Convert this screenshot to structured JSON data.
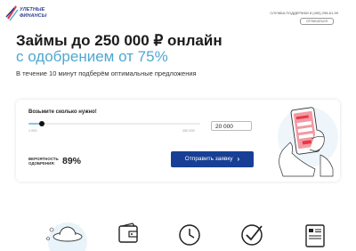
{
  "header": {
    "logo_line1": "УЛЕТНЫЕ",
    "logo_line2": "ФИНАНСЫ",
    "support": "СЛУЖБА ПОДДЕРЖКИ 8 (495) 298-61-99",
    "logout_label": "ОТПИСАТЬСЯ"
  },
  "hero": {
    "title": "Займы до 250 000 ₽ онлайн",
    "subtitle": "с одобрением от 75%",
    "lead": "В течение 10 минут подберём оптимальные предложения"
  },
  "calculator": {
    "question": "Возьмите сколько нужно!",
    "min_label": "1 000",
    "max_label": "250 000",
    "slider_min": 1000,
    "slider_max": 250000,
    "slider_value": 20000,
    "amount_value": "20 000",
    "probability_label": "ВЕРОЯТНОСТЬ ОДОБРЕНИЯ:",
    "probability_value": "89%",
    "submit_label": "Отправить заявку"
  },
  "features": {
    "icons": [
      "ufo-icon",
      "wallet-icon",
      "clock-icon",
      "checkmark-icon",
      "document-icon"
    ]
  },
  "colors": {
    "accent": "#4fa8d1",
    "button": "#173f95",
    "brand_red": "#e63946"
  }
}
